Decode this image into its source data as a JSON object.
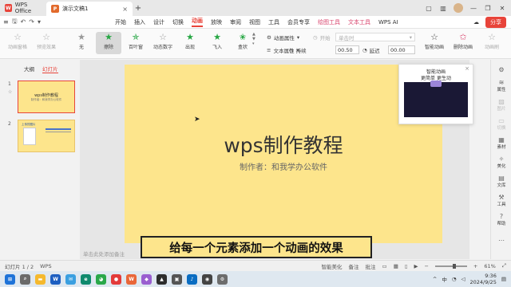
{
  "titlebar": {
    "home_tab": "WPS Office",
    "doc_tab": "演示文稿1",
    "close_glyph": "×",
    "plus_glyph": "+"
  },
  "menubar": {
    "items": [
      "开始",
      "插入",
      "设计",
      "切换",
      "动画",
      "放映",
      "审阅",
      "视图",
      "工具",
      "会员专享"
    ],
    "active": "动画",
    "special_items": [
      "绘图工具",
      "文本工具"
    ],
    "wps_ai": "WPS AI",
    "share": "分享"
  },
  "ribbon": {
    "anim_pane": "动画窗格",
    "preview": "预览效果",
    "gallery": [
      "无",
      "擦除",
      "百叶窗",
      "动态数字",
      "出现",
      "飞入",
      "盒状"
    ],
    "anim_props": "动画属性",
    "text_props": "文本属性",
    "start_label": "开始",
    "start_value": "单击时",
    "duration_label": "持续",
    "duration_value": "00.50",
    "delay_label": "延迟",
    "delay_value": "00.00",
    "smart_anim": "智能动画",
    "delete_anim": "删除动画",
    "anim_brush": "动画刷"
  },
  "left_panel": {
    "tab_outline": "大纲",
    "tab_slides": "幻灯片",
    "slide1_title": "wps制作教程",
    "slide1_sub": "制作者：和我学办公软件",
    "slide2_title": "上传的图片"
  },
  "slide": {
    "title": "wps制作教程",
    "subtitle": "制作者：和我学办公软件"
  },
  "notes_placeholder": "单击此处添加备注",
  "popup": {
    "title": "智能动画",
    "sub": "更简单 更生动",
    "close": "×"
  },
  "right_sidebar": [
    "属性",
    "图片",
    "切换",
    "素材",
    "美化",
    "文库",
    "工具",
    "帮助"
  ],
  "overlay_subtitle": "给每一个元素添加一个动画的效果",
  "statusbar": {
    "slide_count": "幻灯片 1 / 2",
    "wps": "WPS",
    "smart_beautify": "智能美化",
    "notes": "备注",
    "comment": "批注",
    "zoom": "61%"
  },
  "taskbar": {
    "time": "9:36",
    "date": "2024/9/25"
  }
}
